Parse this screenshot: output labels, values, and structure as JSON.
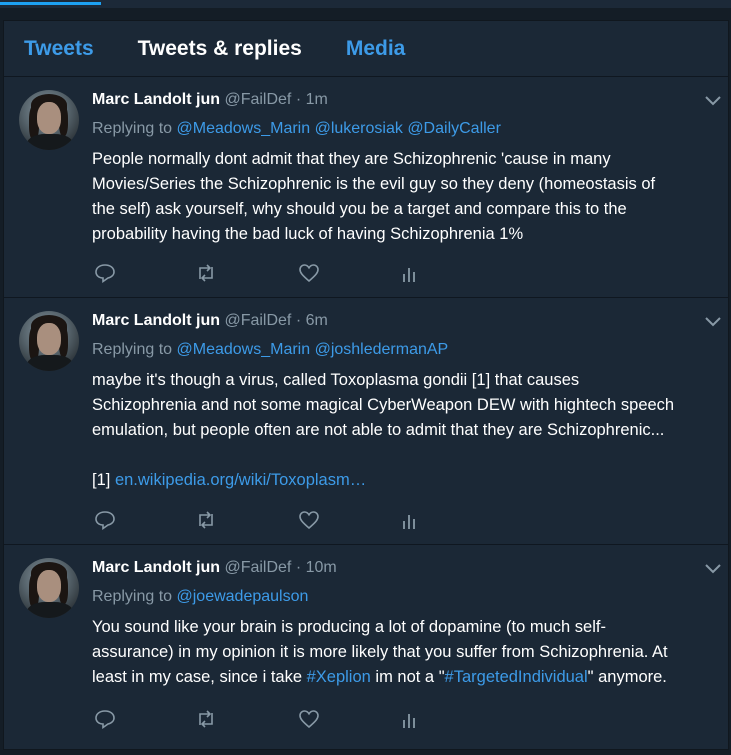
{
  "tabs": [
    {
      "label": "Tweets"
    },
    {
      "label": "Tweets & replies"
    },
    {
      "label": "Media"
    }
  ],
  "tweets": [
    {
      "name": "Marc Landolt jun",
      "handle": "@FailDef",
      "separator": "·",
      "time": "1m",
      "replying_prefix": "Replying to",
      "mentions": [
        "@Meadows_Marin",
        "@lukerosiak",
        "@DailyCaller"
      ],
      "text_lines": [
        "People normally dont admit that they are Schizophrenic 'cause in many",
        "Movies/Series the Schizophrenic is the evil guy so they deny (homeostasis of",
        "the self) ask yourself, why should you be a target and compare this to the",
        "probability having the bad luck of having Schizophrenia 1%"
      ]
    },
    {
      "name": "Marc Landolt jun",
      "handle": "@FailDef",
      "separator": "·",
      "time": "6m",
      "replying_prefix": "Replying to",
      "mentions": [
        "@Meadows_Marin",
        "@joshledermanAP"
      ],
      "text_lines": [
        "maybe it's though a virus, called Toxoplasma gondii [1] that causes",
        "Schizophrenia and not some magical CyberWeapon DEW with hightech speech",
        "emulation, but people often are not able to admit that they are Schizophrenic..."
      ],
      "footnote_label": "[1]",
      "footnote_link": "en.wikipedia.org/wiki/Toxoplasm…"
    },
    {
      "name": "Marc Landolt jun",
      "handle": "@FailDef",
      "separator": "·",
      "time": "10m",
      "replying_prefix": "Replying to",
      "mentions": [
        "@joewadepaulson"
      ],
      "text_lines": [
        "You sound like your brain is producing a lot of dopamine (to much self-",
        "assurance) in my opinion it is more likely that you suffer from Schizophrenia. At"
      ],
      "last_line": {
        "before": "least in my case, since i take ",
        "hashtag1": "#Xeplion",
        "middle": " im not a \"",
        "hashtag2": "#TargetedIndividual",
        "after": "\" anymore."
      }
    }
  ],
  "icons": [
    "reply-icon",
    "retweet-icon",
    "like-icon",
    "analytics-icon",
    "chevron-down-icon"
  ],
  "colors": {
    "accent": "#3d9be8",
    "muted": "#8899a6",
    "panel": "#1b2836",
    "background": "#141d26"
  }
}
